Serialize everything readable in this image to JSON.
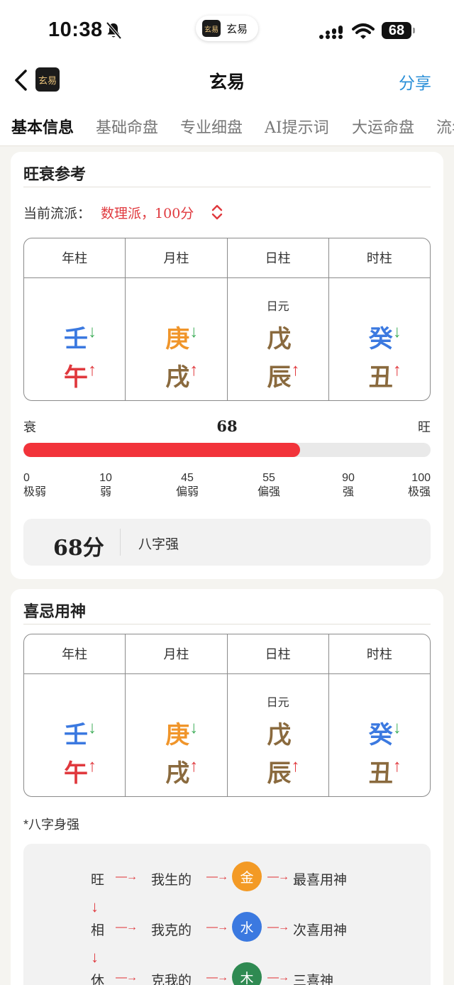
{
  "status": {
    "time": "10:38",
    "island_app": "玄易",
    "battery": "68"
  },
  "nav": {
    "logo_text": "玄易",
    "title": "玄易",
    "share": "分享"
  },
  "tabs": [
    "基本信息",
    "基础命盘",
    "专业细盘",
    "AI提示词",
    "大运命盘",
    "流年"
  ],
  "strength": {
    "title": "旺衰参考",
    "school_label": "当前流派：",
    "school_value": "数理派，100分",
    "weak_label": "衰",
    "strong_label": "旺",
    "score": 68,
    "ticks": [
      {
        "value": "0",
        "label": "极弱"
      },
      {
        "value": "10",
        "label": "弱"
      },
      {
        "value": "45",
        "label": "偏弱"
      },
      {
        "value": "55",
        "label": "偏强"
      },
      {
        "value": "90",
        "label": "强"
      },
      {
        "value": "100",
        "label": "极强"
      }
    ],
    "score_text": "68分",
    "score_desc": "八字强"
  },
  "pillars": {
    "headers": [
      "年柱",
      "月柱",
      "日柱",
      "时柱"
    ],
    "day_master_label": "日元",
    "cols": [
      {
        "stem": "壬",
        "stem_arrow": "↓",
        "branch": "午",
        "branch_arrow": "↑"
      },
      {
        "stem": "庚",
        "stem_arrow": "↓",
        "branch": "戌",
        "branch_arrow": "↑"
      },
      {
        "stem": "戊",
        "stem_arrow": "",
        "branch": "辰",
        "branch_arrow": "↑"
      },
      {
        "stem": "癸",
        "stem_arrow": "↓",
        "branch": "丑",
        "branch_arrow": "↑"
      }
    ],
    "colors": {
      "water": "#3b79e0",
      "metal": "#f0952a",
      "earth": "#8a6a3e",
      "fire": "#e0393e",
      "down": "#3fae5a",
      "up": "#e0393e"
    }
  },
  "favorable": {
    "title": "喜忌用神",
    "note": "*八字身强",
    "rows": [
      {
        "state": "旺",
        "relation": "我生的",
        "element": "金",
        "element_color": "#f39a25",
        "result": "最喜用神"
      },
      {
        "state": "相",
        "relation": "我克的",
        "element": "水",
        "element_color": "#3b79e0",
        "result": "次喜用神"
      },
      {
        "state": "休",
        "relation": "克我的",
        "element": "木",
        "element_color": "#2f8a52",
        "result": "三喜神"
      }
    ],
    "arrow_right": "—→",
    "arrow_down": "↓"
  }
}
